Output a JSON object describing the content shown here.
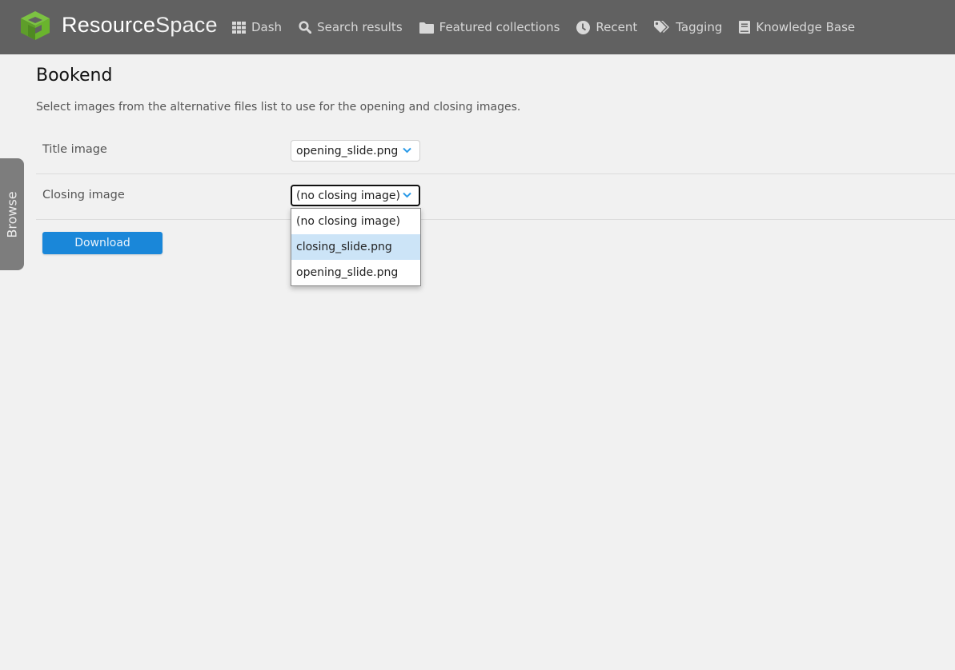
{
  "header": {
    "brand_bold": "Resource",
    "brand_light": "Space",
    "nav": [
      {
        "label": "Dash",
        "icon": "grid-icon"
      },
      {
        "label": "Search results",
        "icon": "search-icon"
      },
      {
        "label": "Featured collections",
        "icon": "folder-icon"
      },
      {
        "label": "Recent",
        "icon": "clock-icon"
      },
      {
        "label": "Tagging",
        "icon": "tags-icon"
      },
      {
        "label": "Knowledge Base",
        "icon": "book-icon"
      }
    ]
  },
  "sidebar": {
    "browse_label": "Browse"
  },
  "main": {
    "title": "Bookend",
    "intro": "Select images from the alternative files list to use for the opening and closing images.",
    "fields": [
      {
        "label": "Title image",
        "value": "opening_slide.png"
      },
      {
        "label": "Closing image",
        "value": "(no closing image)"
      }
    ],
    "dropdown_options": [
      {
        "label": "(no closing image)",
        "highlighted": false
      },
      {
        "label": "closing_slide.png",
        "highlighted": true
      },
      {
        "label": "opening_slide.png",
        "highlighted": false
      }
    ],
    "download_label": "Download"
  },
  "colors": {
    "header_bg": "#616161",
    "accent": "#1a87d9",
    "highlight": "#cce4f7",
    "logo_green": "#6ab42d"
  }
}
